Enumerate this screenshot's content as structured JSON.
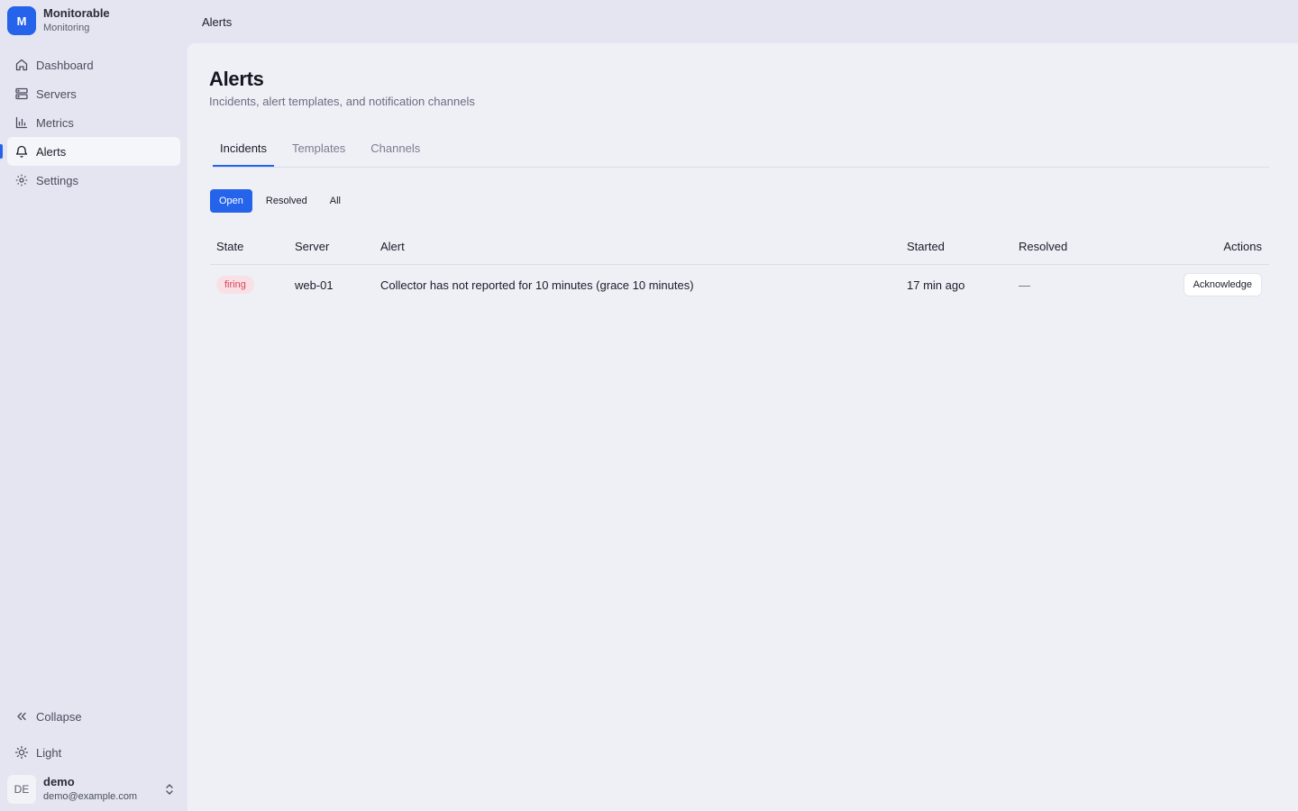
{
  "brand": {
    "logo_letter": "M",
    "name": "Monitorable",
    "subtitle": "Monitoring"
  },
  "sidebar": {
    "items": [
      {
        "label": "Dashboard",
        "icon": "home-icon"
      },
      {
        "label": "Servers",
        "icon": "server-icon"
      },
      {
        "label": "Metrics",
        "icon": "bar-chart-icon"
      },
      {
        "label": "Alerts",
        "icon": "bell-icon",
        "active": true
      },
      {
        "label": "Settings",
        "icon": "gear-icon"
      }
    ],
    "collapse_label": "Collapse",
    "theme_label": "Light"
  },
  "user": {
    "initials": "DE",
    "name": "demo",
    "email": "demo@example.com"
  },
  "topbar": {
    "breadcrumb": "Alerts"
  },
  "page": {
    "title": "Alerts",
    "subtitle": "Incidents, alert templates, and notification channels"
  },
  "tabs": [
    {
      "label": "Incidents",
      "active": true
    },
    {
      "label": "Templates"
    },
    {
      "label": "Channels"
    }
  ],
  "filters": [
    {
      "label": "Open",
      "active": true
    },
    {
      "label": "Resolved"
    },
    {
      "label": "All"
    }
  ],
  "table": {
    "headers": {
      "state": "State",
      "server": "Server",
      "alert": "Alert",
      "started": "Started",
      "resolved": "Resolved",
      "actions": "Actions"
    },
    "rows": [
      {
        "state": "firing",
        "server": "web-01",
        "alert": "Collector has not reported for 10 minutes (grace 10 minutes)",
        "started": "17 min ago",
        "resolved": "—",
        "action_label": "Acknowledge"
      }
    ]
  },
  "colors": {
    "accent": "#2563eb",
    "firing_text": "#d6455d",
    "firing_bg": "#f9e0e4"
  }
}
